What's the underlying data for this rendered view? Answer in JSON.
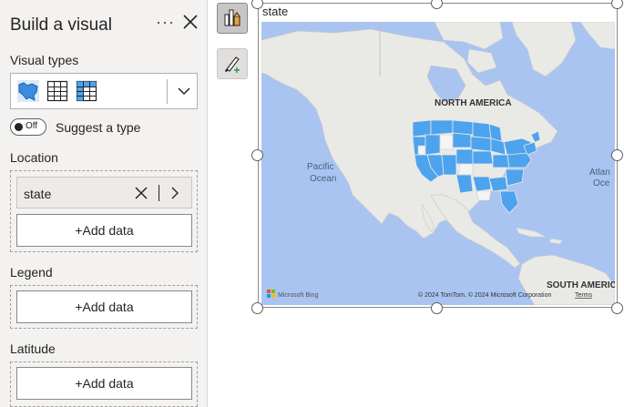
{
  "pane": {
    "title": "Build a visual",
    "more_label": "···",
    "visual_types_label": "Visual types",
    "visual_type_icons": [
      "filled-map-icon",
      "table-icon",
      "matrix-icon"
    ],
    "suggest_toggle": "Off",
    "suggest_label": "Suggest a type",
    "location_label": "Location",
    "location_field": "state",
    "add_data_label": "+Add data",
    "legend_label": "Legend",
    "latitude_label": "Latitude"
  },
  "visual": {
    "title": "state",
    "map_labels": {
      "north_america": "NORTH AMERICA",
      "pacific": "Pacific",
      "ocean_left": "Ocean",
      "atlantic": "Atlan",
      "ocean_right": "Oce",
      "south_america": "SOUTH AMERIC"
    },
    "bing_logo": "Microsoft Bing",
    "copyright": "© 2024 TomTom, © 2024 Microsoft Corporation",
    "terms": "Terms"
  },
  "colors": {
    "ocean": "#a9c4f0",
    "land": "#e9e9e6",
    "filled_region": "#4da3ee",
    "pane_bg": "#f3f2f1"
  }
}
